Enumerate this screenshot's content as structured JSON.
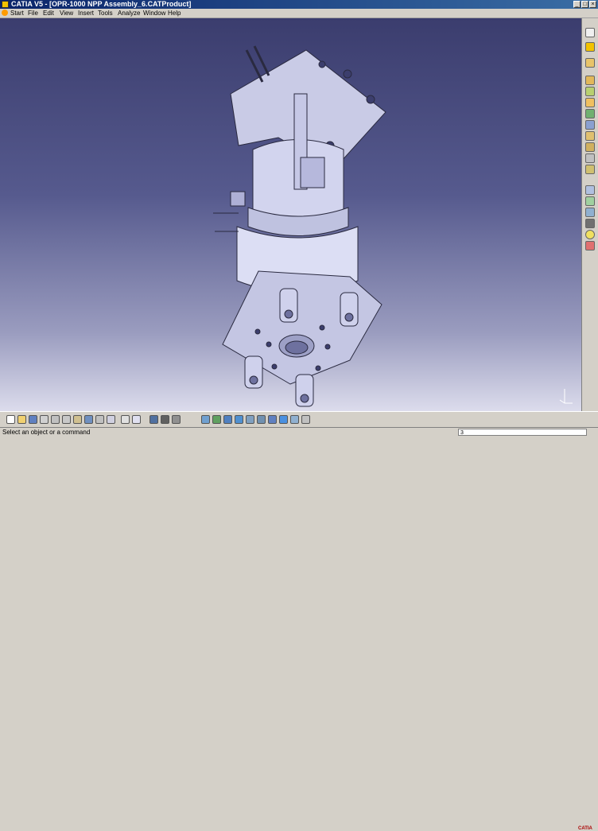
{
  "window": {
    "title": "CATIA V5 - [OPR-1000 NPP Assembly_6.CATProduct]",
    "controls": [
      "_",
      "□",
      "×"
    ]
  },
  "menu": {
    "start": "Start",
    "items": [
      "File",
      "Edit",
      "View",
      "Insert",
      "Tools",
      "Analyze",
      "Window",
      "Help"
    ]
  },
  "right_toolbar": {
    "icons": [
      "select-icon",
      "fly-icon",
      "product-icon",
      "component-icon",
      "part-icon",
      "existing-component-icon",
      "replace-icon",
      "reorder-icon",
      "generate-numbering-icon",
      "reconnect-icon",
      "manage-representations-icon",
      "fast-multi-instantiation-icon",
      "assembly-features-icon",
      "constraint-icon",
      "fix-icon",
      "contact-icon",
      "offset-icon",
      "angle-icon",
      "update-icon",
      "light-bulb-icon",
      "hide-icon"
    ]
  },
  "bottom_toolbar": {
    "icons": [
      "new-icon",
      "open-icon",
      "save-icon",
      "print-icon",
      "cut-icon",
      "copy-icon",
      "paste-icon",
      "undo-icon",
      "redo-icon",
      "whats-this-icon",
      "formula-icon",
      "macro-icon",
      "multi-view-icon",
      "catalog-icon",
      "fly-mode-icon",
      "fit-all-icon",
      "pan-icon",
      "rotate-icon",
      "zoom-in-icon",
      "zoom-out-icon",
      "normal-view-icon",
      "iso-view-icon",
      "shading-icon",
      "hide-show-icon",
      "swap-space-icon"
    ]
  },
  "status": {
    "message": "Select an object or a command",
    "command_value": "3"
  },
  "logo": "CATIA"
}
